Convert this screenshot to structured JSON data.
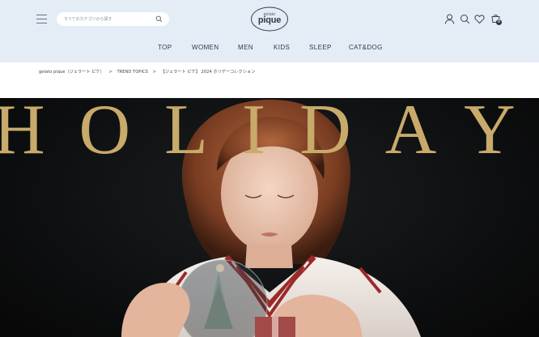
{
  "header": {
    "search_placeholder": "すべてのカテゴリから探す",
    "logo_small": "gelato",
    "logo_main": "pique",
    "cart_count": "0"
  },
  "nav": {
    "items": [
      {
        "label": "TOP"
      },
      {
        "label": "WOMEN"
      },
      {
        "label": "MEN"
      },
      {
        "label": "KIDS"
      },
      {
        "label": "SLEEP"
      },
      {
        "label": "CAT&DOG"
      }
    ]
  },
  "breadcrumb": {
    "items": [
      {
        "label": "gelato pique（ジェラート ピケ）"
      },
      {
        "label": "TREND TOPICS"
      },
      {
        "label": "【ジェラート ピケ】 2024 ホリデーコレクション"
      }
    ],
    "separator": ">"
  },
  "hero": {
    "title": "HOLIDAY",
    "colors": {
      "title": "#c8aa6a",
      "background": "#0c0d0e",
      "sweater": "#f2ebe6",
      "stripe": "#9a2a2a",
      "hair": "#8a4a2e"
    }
  },
  "icons": [
    "menu-icon",
    "search-icon",
    "user-icon",
    "search-icon",
    "heart-icon",
    "cart-icon"
  ]
}
